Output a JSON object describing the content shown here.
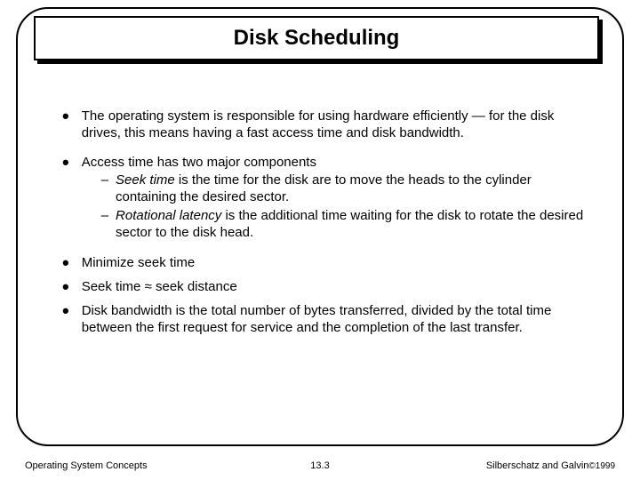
{
  "title": "Disk Scheduling",
  "bullets": {
    "b1": "The operating system is responsible for using hardware efficiently — for the disk drives, this means having a fast access time and disk bandwidth.",
    "b2": {
      "lead": "Access time has two major components",
      "s1_em": "Seek time",
      "s1_rest": " is the time for the disk are to move the heads to the cylinder containing the desired sector.",
      "s2_em": "Rotational latency",
      "s2_rest": " is the additional time waiting for the disk to rotate the desired sector to the disk head."
    },
    "b3": "Minimize seek time",
    "b4_pre": "Seek time ",
    "b4_sym": "≈",
    "b4_post": " seek distance",
    "b5": "Disk bandwidth is the total number of bytes transferred, divided by the total time between the first request for service and the completion of the last transfer."
  },
  "footer": {
    "left": "Operating System Concepts",
    "center": "13.3",
    "right_name": "Silberschatz and Galvin",
    "right_copy": "©1999"
  },
  "glyphs": {
    "bullet": "•",
    "dash": "–"
  }
}
